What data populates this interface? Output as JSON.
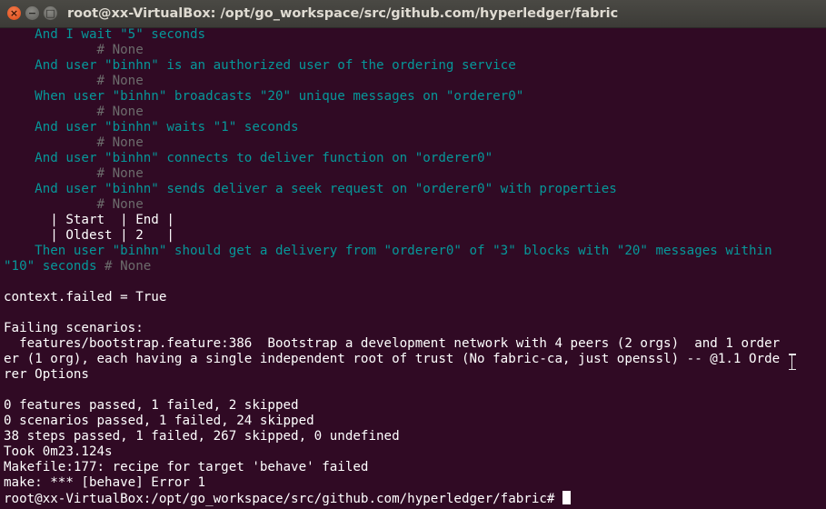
{
  "window": {
    "title": "root@xx-VirtualBox: /opt/go_workspace/src/github.com/hyperledger/fabric",
    "close_glyph": "×",
    "minimize_glyph": "−",
    "maximize_glyph": "□"
  },
  "terminal": {
    "lines": [
      {
        "text": "    And I wait \"5\" seconds",
        "color": "step"
      },
      {
        "text": "            # None",
        "color": "comment"
      },
      {
        "text": "    And user \"binhn\" is an authorized user of the ordering service",
        "color": "step"
      },
      {
        "text": "            # None",
        "color": "comment"
      },
      {
        "text": "    When user \"binhn\" broadcasts \"20\" unique messages on \"orderer0\"",
        "color": "step"
      },
      {
        "text": "            # None",
        "color": "comment"
      },
      {
        "text": "    And user \"binhn\" waits \"1\" seconds",
        "color": "step"
      },
      {
        "text": "            # None",
        "color": "comment"
      },
      {
        "text": "    And user \"binhn\" connects to deliver function on \"orderer0\"",
        "color": "step"
      },
      {
        "text": "            # None",
        "color": "comment"
      },
      {
        "text": "    And user \"binhn\" sends deliver a seek request on \"orderer0\" with properties",
        "color": "step"
      },
      {
        "text": "            # None",
        "color": "comment"
      },
      {
        "text": "      | Start  | End |",
        "color": "white"
      },
      {
        "text": "      | Oldest | 2   |",
        "color": "white"
      },
      {
        "text": "    Then user \"binhn\" should get a delivery from \"orderer0\" of \"3\" blocks with \"20\" messages within",
        "color": "step"
      },
      {
        "text": "\"10\" seconds",
        "color": "step",
        "suffix": " # None"
      },
      {
        "text": "",
        "color": "white"
      },
      {
        "text": "context.failed = True",
        "color": "white"
      },
      {
        "text": "",
        "color": "white"
      },
      {
        "text": "Failing scenarios:",
        "color": "white"
      },
      {
        "text": "  features/bootstrap.feature:386  Bootstrap a development network with 4 peers (2 orgs)  and 1 order",
        "color": "white"
      },
      {
        "text": "er (1 org), each having a single independent root of trust (No fabric-ca, just openssl) -- @1.1 Orde",
        "color": "white"
      },
      {
        "text": "rer Options",
        "color": "white"
      },
      {
        "text": "",
        "color": "white"
      },
      {
        "text": "0 features passed, 1 failed, 2 skipped",
        "color": "white"
      },
      {
        "text": "0 scenarios passed, 1 failed, 24 skipped",
        "color": "white"
      },
      {
        "text": "38 steps passed, 1 failed, 267 skipped, 0 undefined",
        "color": "white"
      },
      {
        "text": "Took 0m23.124s",
        "color": "white"
      },
      {
        "text": "Makefile:177: recipe for target 'behave' failed",
        "color": "white"
      },
      {
        "text": "make: *** [behave] Error 1",
        "color": "white"
      },
      {
        "text": "root@xx-VirtualBox:/opt/go_workspace/src/github.com/hyperledger/fabric# ",
        "color": "white",
        "cursor": true
      }
    ],
    "colors": {
      "background": "#300a24",
      "step": "#06989a",
      "comment": "#6c6c6c",
      "white": "#ffffff"
    }
  }
}
